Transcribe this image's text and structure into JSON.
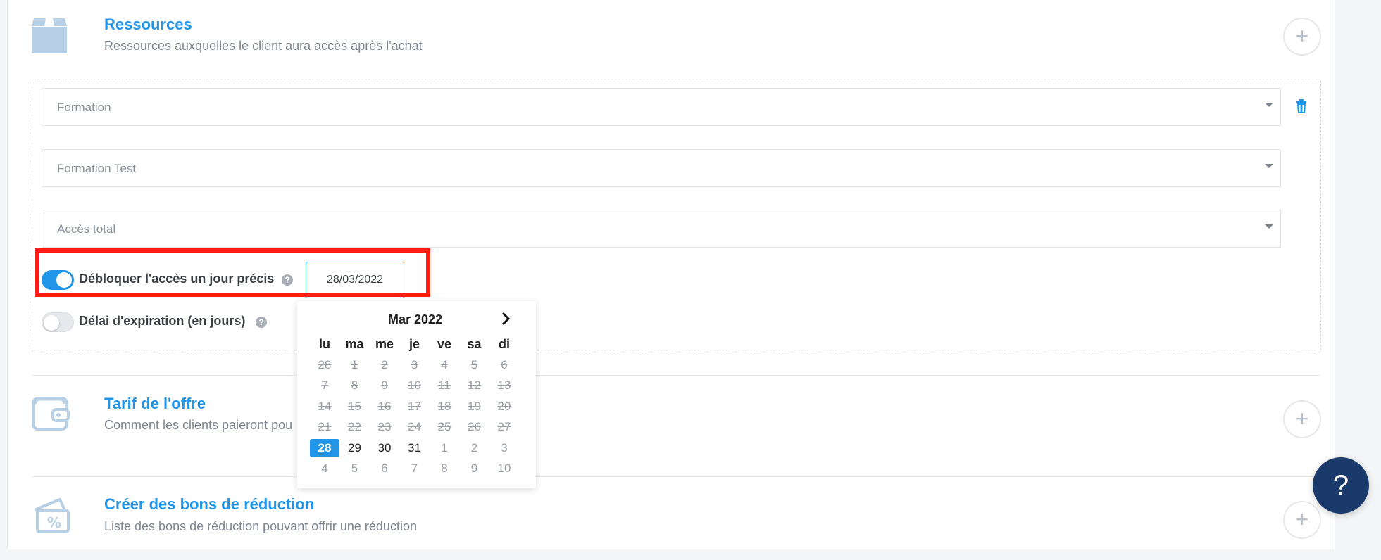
{
  "sections": {
    "ressources": {
      "title": "Ressources",
      "subtitle": "Ressources auxquelles le client aura accès après l'achat",
      "plus_label": "+"
    },
    "tarif": {
      "title": "Tarif de l'offre",
      "subtitle": "Comment les clients paieront pou",
      "plus_label": "+"
    },
    "bons": {
      "title": "Créer des bons de réduction",
      "subtitle": "Liste des bons de réduction pouvant offrir une réduction",
      "plus_label": "+"
    }
  },
  "resource": {
    "type_select": "Formation",
    "item_select": "Formation Test",
    "access_select": "Accès total",
    "unlock_toggle": {
      "label": "Débloquer l'accès un jour précis",
      "on": true
    },
    "unlock_date": "28/03/2022",
    "expiry_toggle": {
      "label": "Délai d'expiration (en jours)",
      "on": false
    },
    "help_glyph": "?"
  },
  "calendar": {
    "month_label": "Mar 2022",
    "weekdays": [
      "lu",
      "ma",
      "me",
      "je",
      "ve",
      "sa",
      "di"
    ],
    "weeks": [
      [
        {
          "d": "28",
          "s": "disabled"
        },
        {
          "d": "1",
          "s": "disabled"
        },
        {
          "d": "2",
          "s": "disabled"
        },
        {
          "d": "3",
          "s": "disabled"
        },
        {
          "d": "4",
          "s": "disabled"
        },
        {
          "d": "5",
          "s": "disabled"
        },
        {
          "d": "6",
          "s": "disabled"
        }
      ],
      [
        {
          "d": "7",
          "s": "disabled"
        },
        {
          "d": "8",
          "s": "disabled"
        },
        {
          "d": "9",
          "s": "disabled"
        },
        {
          "d": "10",
          "s": "disabled"
        },
        {
          "d": "11",
          "s": "disabled"
        },
        {
          "d": "12",
          "s": "disabled"
        },
        {
          "d": "13",
          "s": "disabled"
        }
      ],
      [
        {
          "d": "14",
          "s": "disabled"
        },
        {
          "d": "15",
          "s": "disabled"
        },
        {
          "d": "16",
          "s": "disabled"
        },
        {
          "d": "17",
          "s": "disabled"
        },
        {
          "d": "18",
          "s": "disabled"
        },
        {
          "d": "19",
          "s": "disabled"
        },
        {
          "d": "20",
          "s": "disabled"
        }
      ],
      [
        {
          "d": "21",
          "s": "disabled"
        },
        {
          "d": "22",
          "s": "disabled"
        },
        {
          "d": "23",
          "s": "disabled"
        },
        {
          "d": "24",
          "s": "disabled"
        },
        {
          "d": "25",
          "s": "disabled"
        },
        {
          "d": "26",
          "s": "disabled"
        },
        {
          "d": "27",
          "s": "disabled"
        }
      ],
      [
        {
          "d": "28",
          "s": "selected"
        },
        {
          "d": "29",
          "s": "active"
        },
        {
          "d": "30",
          "s": "active"
        },
        {
          "d": "31",
          "s": "active"
        },
        {
          "d": "1",
          "s": "other"
        },
        {
          "d": "2",
          "s": "other"
        },
        {
          "d": "3",
          "s": "other"
        }
      ],
      [
        {
          "d": "4",
          "s": "other"
        },
        {
          "d": "5",
          "s": "other"
        },
        {
          "d": "6",
          "s": "other"
        },
        {
          "d": "7",
          "s": "other"
        },
        {
          "d": "8",
          "s": "other"
        },
        {
          "d": "9",
          "s": "other"
        },
        {
          "d": "10",
          "s": "other"
        }
      ]
    ]
  },
  "help_fab": "?",
  "colors": {
    "accent": "#2196e8",
    "highlight": "#ff1c12",
    "fab": "#1a3a6b",
    "icon": "#b7d0e6"
  },
  "icons": {
    "ressources": "box-icon",
    "tarif": "wallet-icon",
    "bons": "coupon-icon",
    "trash": "trash-icon",
    "next": "chevron-right-icon"
  }
}
